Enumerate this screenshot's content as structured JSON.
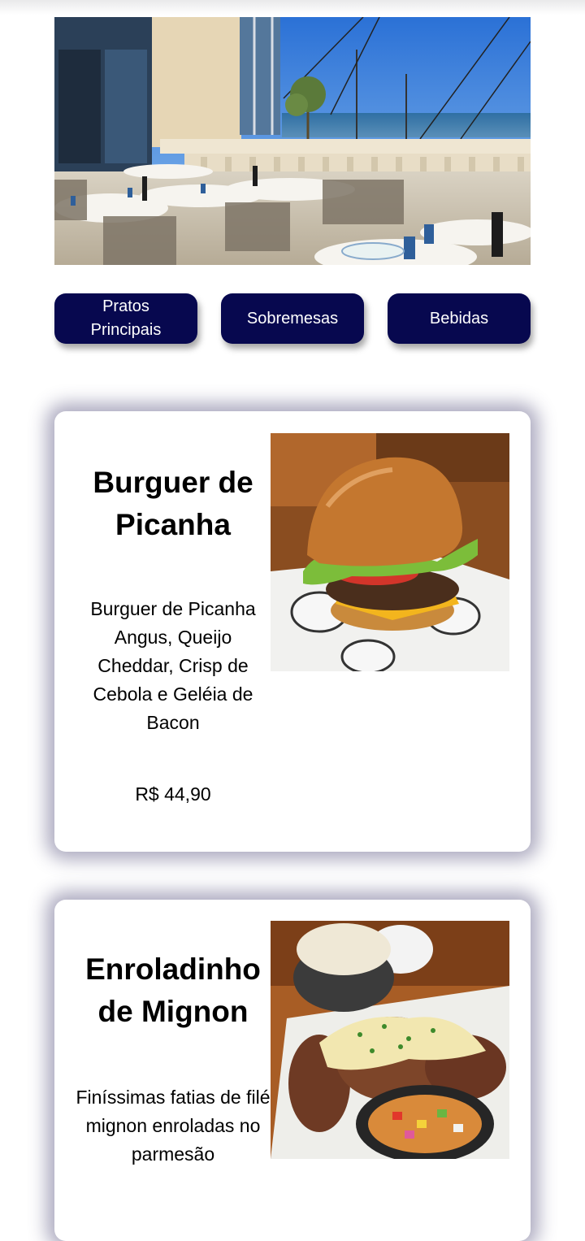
{
  "menu": {
    "tabs": [
      {
        "label": "Pratos Principais"
      },
      {
        "label": "Sobremesas"
      },
      {
        "label": "Bebidas"
      }
    ]
  },
  "items": [
    {
      "title": "Burguer de Picanha",
      "description": "Burguer de Picanha Angus, Queijo Cheddar, Crisp de Cebola e Geléia de Bacon",
      "price": "R$ 44,90"
    },
    {
      "title": "Enroladinho de Mignon",
      "description": "Finíssimas fatias de filé mignon enroladas no parmesão"
    }
  ],
  "colors": {
    "button_bg": "#07084f",
    "button_text": "#ffffff"
  }
}
